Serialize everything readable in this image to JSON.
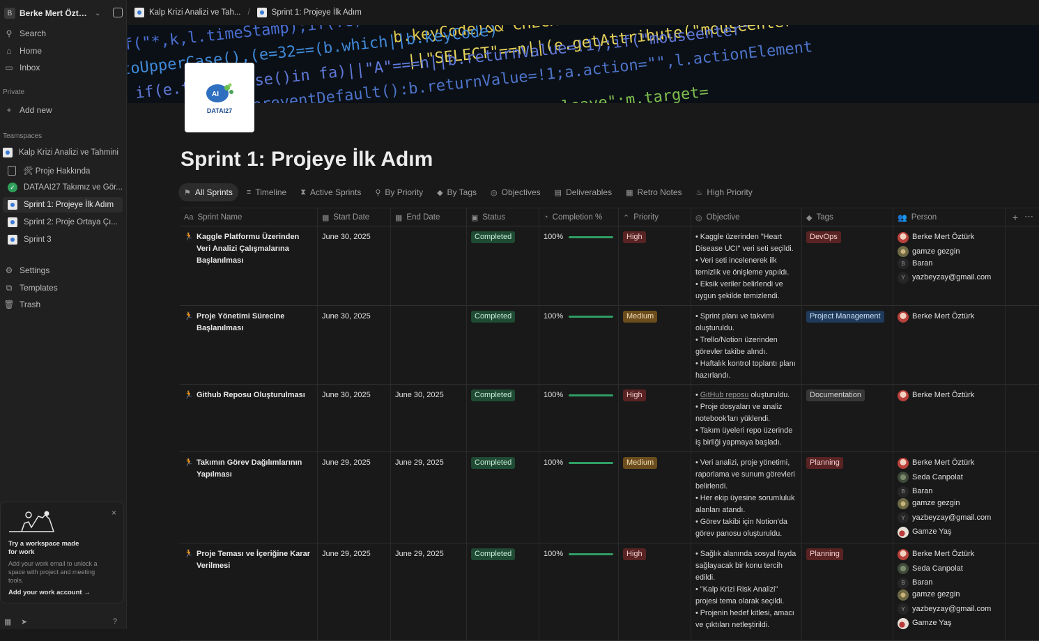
{
  "workspace": {
    "initial": "B",
    "name": "Berke Mert Öztür..."
  },
  "sidebar": {
    "search": "Search",
    "home": "Home",
    "inbox": "Inbox",
    "private_label": "Private",
    "add_new": "Add new",
    "teamspaces_label": "Teamspaces",
    "teamspace_items": [
      "Kalp Krizi Analizi ve Tahmini",
      "🛠 Proje Hakkında",
      "DATAAI27 Takımız ve Gör...",
      "Sprint 1: Projeye İlk Adım",
      "Sprint 2: Proje Ortaya Çı...",
      "Sprint 3"
    ],
    "settings": "Settings",
    "templates": "Templates",
    "trash": "Trash"
  },
  "promo": {
    "title": "Try a workspace made for work",
    "body": "Add your work email to unlock a space with project and meeting tools.",
    "link": "Add your work account",
    "close": "×"
  },
  "breadcrumb": [
    "Kalp Krizi Analizi ve Tah...",
    "Sprint 1: Projeye İlk Adım"
  ],
  "page": {
    "title": "Sprint 1: Projeye İlk Adım",
    "logo_text": "DATAI27"
  },
  "views": [
    {
      "icon": "⚑",
      "label": "All Sprints"
    },
    {
      "icon": "≡",
      "label": "Timeline"
    },
    {
      "icon": "⧗",
      "label": "Active Sprints"
    },
    {
      "icon": "⚲",
      "label": "By Priority"
    },
    {
      "icon": "◆",
      "label": "By Tags"
    },
    {
      "icon": "◎",
      "label": "Objectives"
    },
    {
      "icon": "▤",
      "label": "Deliverables"
    },
    {
      "icon": "▦",
      "label": "Retro Notes"
    },
    {
      "icon": "♨",
      "label": "High Priority"
    }
  ],
  "columns": [
    {
      "icon": "Aa",
      "label": "Sprint Name"
    },
    {
      "icon": "▦",
      "label": "Start Date"
    },
    {
      "icon": "▦",
      "label": "End Date"
    },
    {
      "icon": "▣",
      "label": "Status"
    },
    {
      "icon": "◔",
      "label": "Completion %"
    },
    {
      "icon": "⌃",
      "label": "Priority"
    },
    {
      "icon": "◎",
      "label": "Objective"
    },
    {
      "icon": "◆",
      "label": "Tags"
    },
    {
      "icon": "👥",
      "label": "Person"
    }
  ],
  "rows": [
    {
      "name": "Kaggle Platformu Üzerinden Veri Analizi Çalışmalarına Başlanılması",
      "start": "June 30, 2025",
      "end": "",
      "status": "Completed",
      "completion": "100%",
      "priority": "High",
      "objective": [
        "• Kaggle üzerinden \"Heart Disease UCI\" veri seti seçildi.",
        "• Veri seti incelenerek ilk temizlik ve önişleme yapıldı.",
        "• Eksik veriler belirlendi ve uygun şekilde temizlendi."
      ],
      "tag": "DevOps"
    },
    {
      "name": "Proje Yönetimi Sürecine Başlanılması",
      "start": "June 30, 2025",
      "end": "",
      "status": "Completed",
      "completion": "100%",
      "priority": "Medium",
      "objective": [
        "• Sprint planı ve takvimi oluşturuldu.",
        "• Trello/Notion üzerinden görevler takibe alındı.",
        "• Haftalık kontrol toplantı planı hazırlandı."
      ],
      "tag": "Project Management"
    },
    {
      "name": "Github Reposu Oluşturulması",
      "start": "June 30, 2025",
      "end": "June 30, 2025",
      "status": "Completed",
      "completion": "100%",
      "priority": "High",
      "objective_link": "GitHub reposu",
      "objective": [
        " oluşturuldu.",
        "• Proje dosyaları ve analiz notebook'ları yüklendi.",
        "• Takım üyeleri repo üzerinde iş birliği yapmaya başladı."
      ],
      "tag": "Documentation"
    },
    {
      "name": "Takımın Görev Dağılımlarının Yapılması",
      "start": "June 29, 2025",
      "end": "June 29, 2025",
      "status": "Completed",
      "completion": "100%",
      "priority": "Medium",
      "objective": [
        "• Veri analizi, proje yönetimi, raporlama ve sunum görevleri belirlendi.",
        "• Her ekip üyesine sorumluluk alanları atandı.",
        "• Görev takibi için Notion'da görev panosu oluşturuldu."
      ],
      "tag": "Planning"
    },
    {
      "name": "Proje Teması ve İçeriğine Karar Verilmesi",
      "start": "June 29, 2025",
      "end": "June 29, 2025",
      "status": "Completed",
      "completion": "100%",
      "priority": "High",
      "objective": [
        "• Sağlık alanında sosyal fayda sağlayacak bir konu tercih edildi.",
        "• \"Kalp Krizi Risk Analizi\" projesi tema olarak seçildi.",
        "• Projenin hedef kitlesi, amacı ve çıktıları netleştirildi."
      ],
      "tag": "Planning"
    }
  ],
  "people": {
    "berke": "Berke Mert Öztürk",
    "gamze_g": "gamze gezgin",
    "baran": "Baran",
    "baran_initial": "B",
    "yazbeyzay": "yazbeyzay@gmail.com",
    "yaz_initial": "Y",
    "seda": "Seda Canpolat",
    "gamze_y": "Gamze Yaş"
  },
  "colors": {
    "completed": "#1f4a33",
    "high": "#5a2323",
    "medium": "#6b4c1c",
    "progress": "#2f9e64"
  },
  "completion_fraction": 1.0
}
